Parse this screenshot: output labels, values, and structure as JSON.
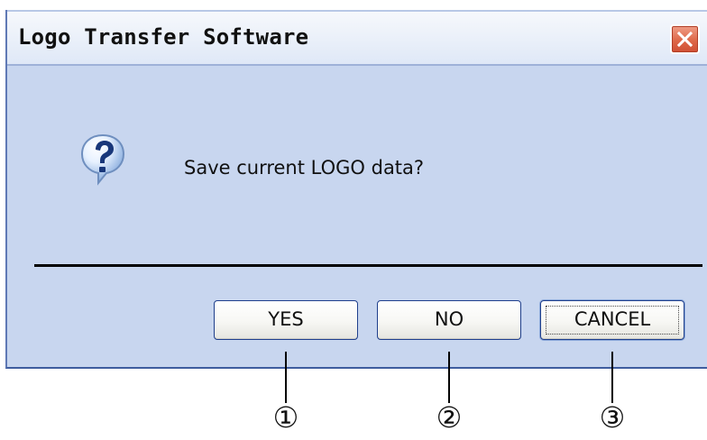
{
  "window": {
    "title": "Logo Transfer Software",
    "close_icon": "close-icon"
  },
  "dialog": {
    "icon": "question-icon",
    "message": "Save current LOGO data?"
  },
  "buttons": {
    "yes": "YES",
    "no": "NO",
    "cancel": "CANCEL"
  },
  "callouts": [
    "①",
    "②",
    "③"
  ],
  "colors": {
    "dialog_background": "#c8d6ef",
    "titlebar_background": "#eef3fb",
    "close_button": "#de6848",
    "button_border": "#1f3f8c",
    "separator": "#000000"
  }
}
